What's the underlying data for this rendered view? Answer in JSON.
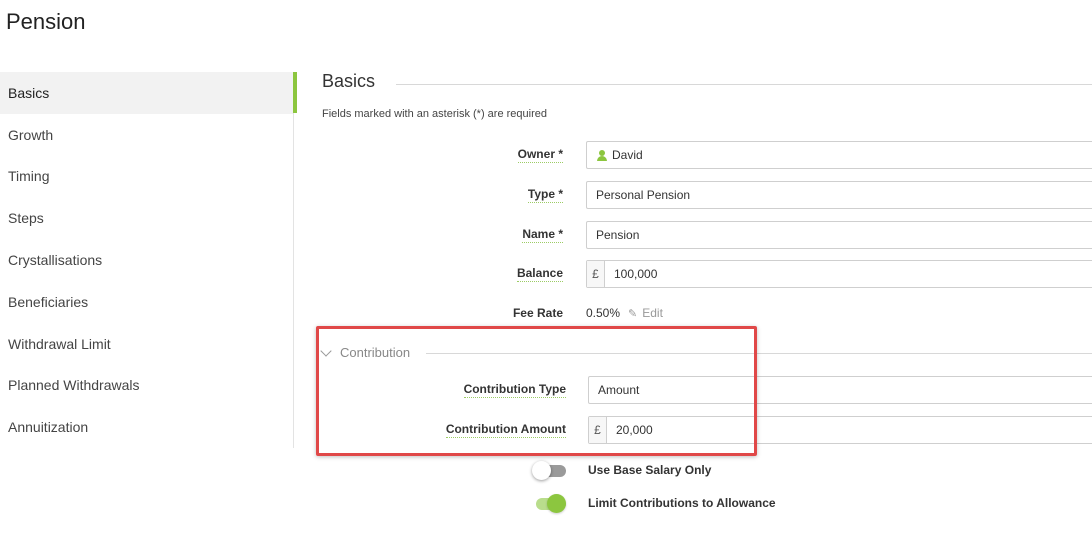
{
  "page": {
    "title": "Pension"
  },
  "sidebar": {
    "items": [
      {
        "label": "Basics",
        "active": true
      },
      {
        "label": "Growth"
      },
      {
        "label": "Timing"
      },
      {
        "label": "Steps"
      },
      {
        "label": "Crystallisations"
      },
      {
        "label": "Beneficiaries"
      },
      {
        "label": "Withdrawal Limit"
      },
      {
        "label": "Planned Withdrawals"
      },
      {
        "label": "Annuitization"
      }
    ]
  },
  "basics": {
    "title": "Basics",
    "required_note": "Fields marked with an asterisk (*) are required",
    "owner": {
      "label": "Owner *",
      "value": "David",
      "icon": "person-icon"
    },
    "type": {
      "label": "Type *",
      "value": "Personal Pension"
    },
    "name": {
      "label": "Name *",
      "value": "Pension"
    },
    "balance": {
      "label": "Balance",
      "currency": "£",
      "value": "100,000"
    },
    "fee_rate": {
      "label": "Fee Rate",
      "value": "0.50%",
      "edit_label": "Edit"
    }
  },
  "contribution": {
    "title": "Contribution",
    "type": {
      "label": "Contribution Type",
      "value": "Amount"
    },
    "amount": {
      "label": "Contribution Amount",
      "currency": "£",
      "value": "20,000"
    }
  },
  "toggles": {
    "base_salary": {
      "label": "Use Base Salary Only",
      "on": false
    },
    "limit_allowance": {
      "label": "Limit Contributions to Allowance",
      "on": true
    }
  },
  "colors": {
    "accent": "#8cc63f",
    "highlight": "#e04848"
  }
}
